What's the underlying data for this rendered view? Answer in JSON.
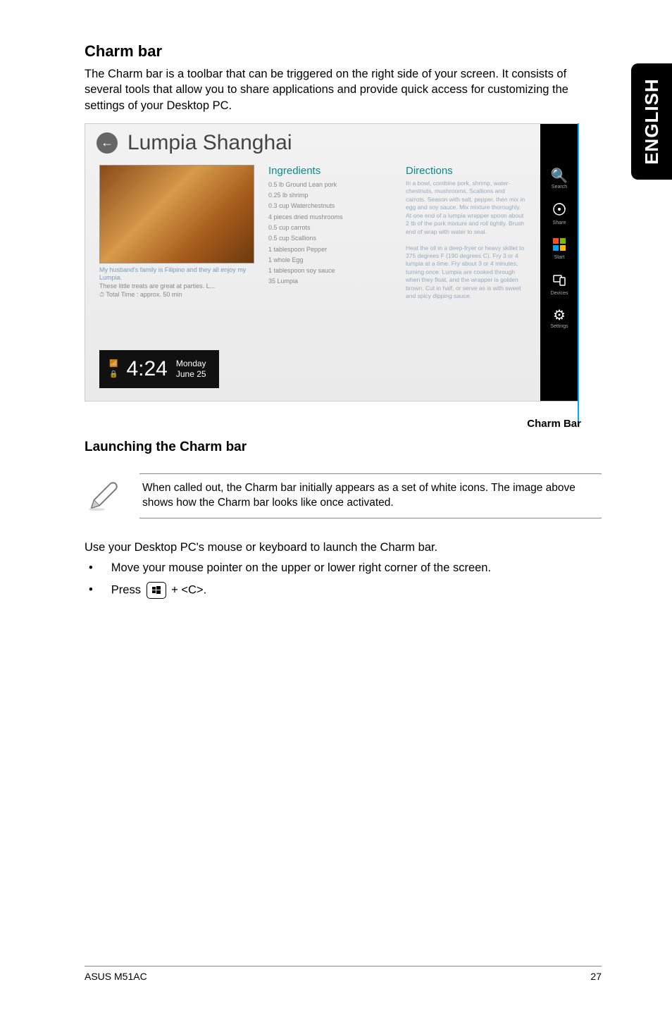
{
  "sideTab": "ENGLISH",
  "heading": "Charm bar",
  "intro": "The Charm bar is a toolbar that can be triggered on the right side of your screen. It consists of several tools that allow you to share applications and provide quick access for customizing the settings of your Desktop PC.",
  "screenshot": {
    "title": "Lumpia Shanghai",
    "caption": {
      "line1": "My husband's family is Filipino and they all enjoy my Lumpia.",
      "line2": "These little treats are great at parties. L...",
      "line3": "Total Time : approx. 50 min"
    },
    "ingredientsHead": "Ingredients",
    "ingredients": [
      "0.5 lb Ground Lean pork",
      "0.25 lb shrimp",
      "0.3 cup Waterchestnuts",
      "4 pieces dried mushrooms",
      "0.5 cup carrots",
      "0.5 cup Scallions",
      "1 tablespoon Pepper",
      "1 whole Egg",
      "1 tablespoon soy sauce",
      "35 Lumpia"
    ],
    "directionsHead": "Directions",
    "directions": "In a bowl, combine pork, shrimp, water-chestnuts, mushrooms, Scallions and carrots. Season with salt, pepper, then mix in egg and soy sauce. Mix mixture thoroughly.\nAt one end of a lumpia wrapper spoon about 2 tb of the pork mixture and roll tightly. Brush end of wrap with water to seal.\n\nHeat the oil in a deep-fryer or heavy skillet to 375 degrees F (190 degrees C). Fry 3 or 4 lumpia at a time. Fry about 3 or 4 minutes, turning once. Lumpia are cooked through when they float, and the wrapper is golden brown. Cut in half, or serve as is with sweet and spicy dipping sauce.",
    "clock": {
      "time": "4:24",
      "weekday": "Monday",
      "date": "June 25"
    },
    "charms": [
      {
        "icon": "🔍",
        "label": "Search"
      },
      {
        "icon": "share",
        "label": "Share"
      },
      {
        "icon": "win",
        "label": "Start"
      },
      {
        "icon": "devices",
        "label": "Devices"
      },
      {
        "icon": "⚙",
        "label": "Settings"
      }
    ]
  },
  "calloutLabel": "Charm Bar",
  "subHeading": "Launching the Charm bar",
  "noteText": "When called out, the Charm bar initially appears as a set of white icons. The image above shows how the Charm bar looks like once activated.",
  "afterNote": "Use your Desktop PC's mouse or keyboard to launch the Charm bar.",
  "bullets": {
    "b1": "Move your mouse pointer on the upper or lower right corner of the screen.",
    "b2a": "Press",
    "b2b": "+ <C>."
  },
  "footer": {
    "left": "ASUS M51AC",
    "right": "27"
  }
}
